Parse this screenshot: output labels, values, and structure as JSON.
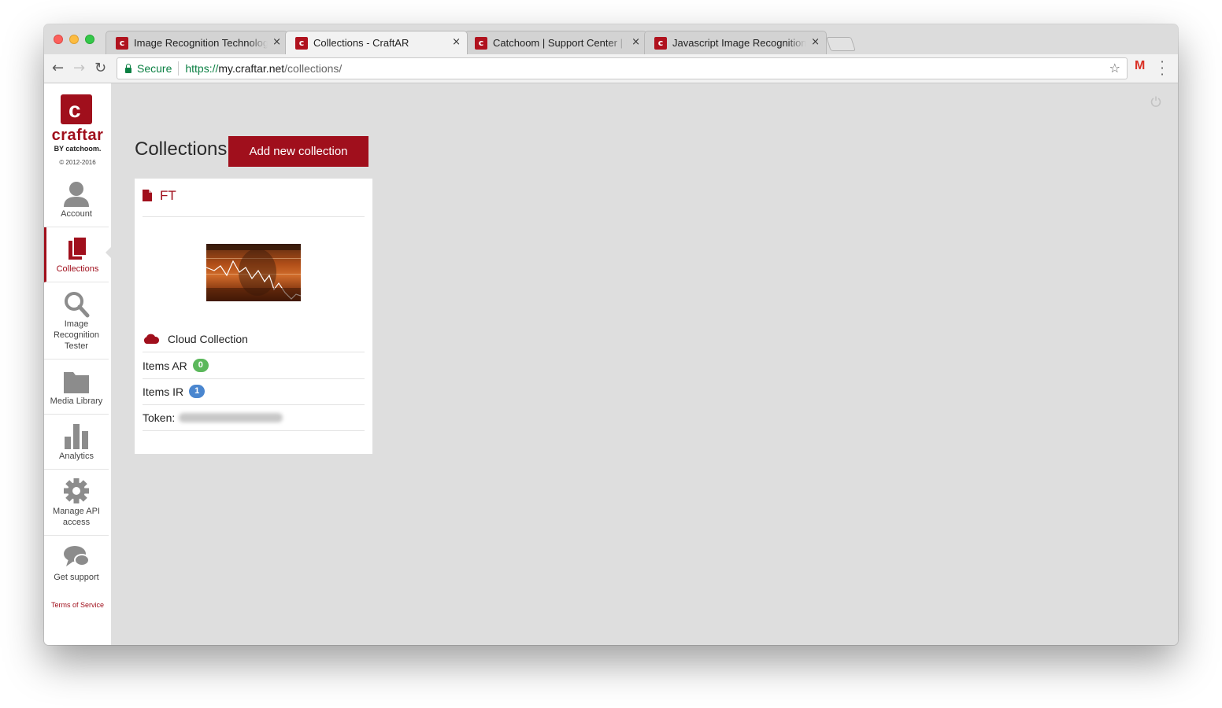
{
  "browser": {
    "tabs": [
      {
        "title": "Image Recognition Technology",
        "active": false
      },
      {
        "title": "Collections - CraftAR",
        "active": true
      },
      {
        "title": "Catchoom | Support Center | P",
        "active": false
      },
      {
        "title": "Javascript Image Recognition |",
        "active": false
      }
    ],
    "tab_close": "×",
    "secure_label": "Secure",
    "url_proto": "https://",
    "url_host": "my.craftar.net",
    "url_path": "/collections/",
    "gmail_letter": "M"
  },
  "logo": {
    "letter": "c",
    "name": "craftar",
    "by": "BY catchoom.",
    "copyright": "© 2012-2016"
  },
  "sidebar": {
    "items": [
      {
        "label": "Account",
        "icon": "user-icon"
      },
      {
        "label": "Collections",
        "icon": "collections-icon",
        "active": true
      },
      {
        "label": "Image Recognition Tester",
        "icon": "search-icon"
      },
      {
        "label": "Media Library",
        "icon": "folder-icon"
      },
      {
        "label": "Analytics",
        "icon": "bar-chart-icon"
      },
      {
        "label": "Manage API access",
        "icon": "gear-icon"
      },
      {
        "label": "Get support",
        "icon": "chat-bubble-icon"
      }
    ],
    "terms": "Terms of Service"
  },
  "main": {
    "title": "Collections",
    "add_button": "Add new collection",
    "collection": {
      "name": "FT",
      "type_label": "Cloud Collection",
      "items_ar_label": "Items AR",
      "items_ar_count": "0",
      "items_ir_label": "Items IR",
      "items_ir_count": "1",
      "token_label": "Token:"
    }
  },
  "colors": {
    "brand": "#a00f1c",
    "badge_green": "#5cb85c",
    "badge_blue": "#4a86cf",
    "content_bg": "#dedede"
  }
}
